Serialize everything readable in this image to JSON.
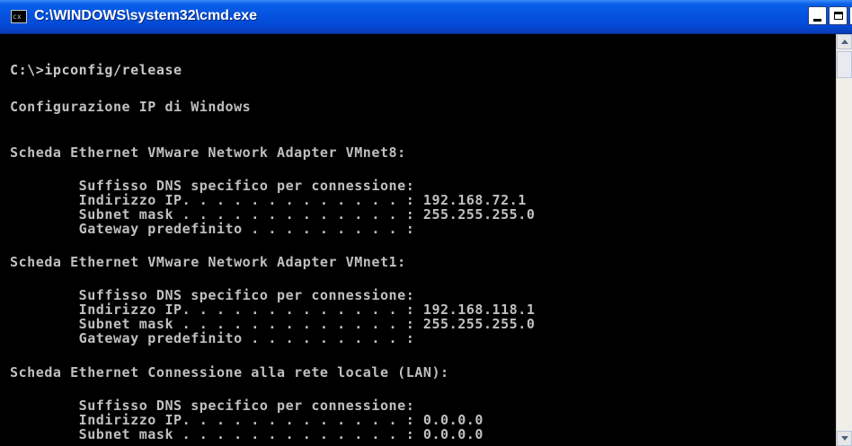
{
  "window": {
    "title": "C:\\WINDOWS\\system32\\cmd.exe",
    "icon_label": "cx"
  },
  "console": {
    "lines": [
      "C:\\>ipconfig/release",
      "Configurazione IP di Windows",
      "Scheda Ethernet VMware Network Adapter VMnet8:",
      "        Suffisso DNS specifico per connessione:",
      "        Indirizzo IP. . . . . . . . . . . . . : 192.168.72.1",
      "        Subnet mask . . . . . . . . . . . . . : 255.255.255.0",
      "        Gateway predefinito . . . . . . . . . :",
      "Scheda Ethernet VMware Network Adapter VMnet1:",
      "        Suffisso DNS specifico per connessione:",
      "        Indirizzo IP. . . . . . . . . . . . . : 192.168.118.1",
      "        Subnet mask . . . . . . . . . . . . . : 255.255.255.0",
      "        Gateway predefinito . . . . . . . . . :",
      "Scheda Ethernet Connessione alla rete locale (LAN):",
      "        Suffisso DNS specifico per connessione:",
      "        Indirizzo IP. . . . . . . . . . . . . : 0.0.0.0",
      "        Subnet mask . . . . . . . . . . . . . : 0.0.0.0"
    ]
  },
  "colors": {
    "titlebar": "#0553e0",
    "console_bg": "#000000",
    "console_text": "#c0c0c0"
  },
  "icons": {
    "app": "cmd-icon",
    "minimize": "minimize-icon",
    "maximize": "maximize-icon",
    "close": "close-icon",
    "scroll_up": "arrow-up-icon",
    "scroll_down": "arrow-down-icon"
  }
}
